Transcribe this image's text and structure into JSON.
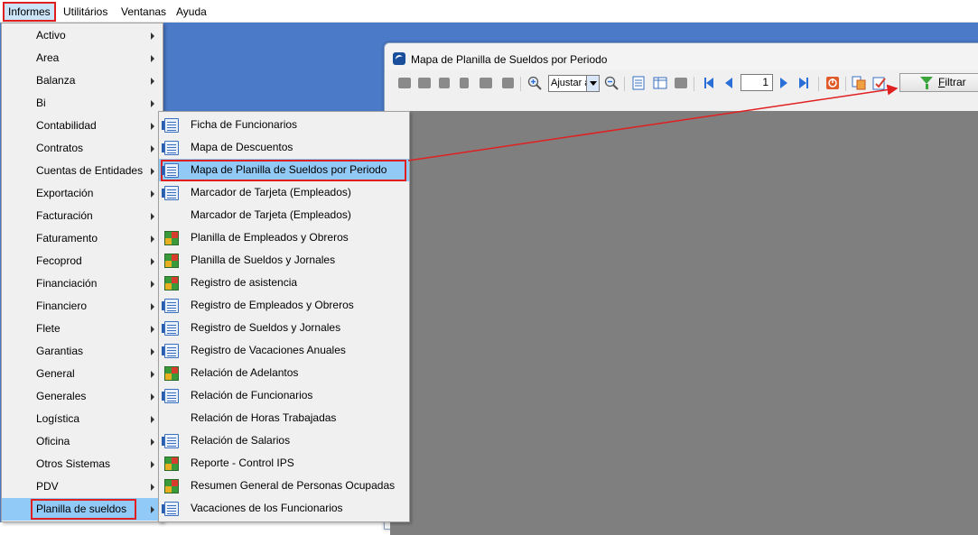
{
  "menubar": {
    "items": [
      {
        "label": "Informes",
        "active": true
      },
      {
        "label": "Utilitários"
      },
      {
        "label": "Ventanas"
      },
      {
        "label": "Ayuda"
      }
    ]
  },
  "report_window": {
    "title": "Mapa de Planilla de Sueldos por Periodo",
    "toolbar": {
      "zoom_value": "Ajustar a",
      "page_number": "1",
      "filter_label_first": "F",
      "filter_label_rest": "iltrar"
    }
  },
  "informes_menu": {
    "items": [
      {
        "label": "Activo"
      },
      {
        "label": "Area"
      },
      {
        "label": "Balanza"
      },
      {
        "label": "Bi"
      },
      {
        "label": "Contabilidad"
      },
      {
        "label": "Contratos"
      },
      {
        "label": "Cuentas de Entidades"
      },
      {
        "label": "Exportación"
      },
      {
        "label": "Facturación"
      },
      {
        "label": "Faturamento"
      },
      {
        "label": "Fecoprod"
      },
      {
        "label": "Financiación"
      },
      {
        "label": "Financiero"
      },
      {
        "label": "Flete"
      },
      {
        "label": "Garantias"
      },
      {
        "label": "General"
      },
      {
        "label": "Generales"
      },
      {
        "label": "Logística"
      },
      {
        "label": "Oficina"
      },
      {
        "label": "Otros Sistemas"
      },
      {
        "label": "PDV"
      },
      {
        "label": "Planilla de sueldos",
        "active": true
      }
    ]
  },
  "planilla_menu": {
    "items": [
      {
        "label": "Ficha de Funcionarios",
        "icon": "report-doc-icon"
      },
      {
        "label": "Mapa de Descuentos",
        "icon": "report-doc-icon"
      },
      {
        "label": "Mapa de Planilla de Sueldos por Periodo",
        "icon": "report-doc-icon",
        "active": true
      },
      {
        "label": "Marcador de Tarjeta (Empleados)",
        "icon": "report-doc-icon"
      },
      {
        "label": "Marcador de Tarjeta (Empleados)",
        "icon": ""
      },
      {
        "label": "Planilla de Empleados y Obreros",
        "icon": "spreadsheet-icon"
      },
      {
        "label": "Planilla de Sueldos y Jornales",
        "icon": "spreadsheet-icon"
      },
      {
        "label": "Registro de asistencia",
        "icon": "spreadsheet-icon"
      },
      {
        "label": "Registro de Empleados y Obreros",
        "icon": "report-doc-icon"
      },
      {
        "label": "Registro de Sueldos y Jornales",
        "icon": "report-doc-icon"
      },
      {
        "label": "Registro de Vacaciones Anuales",
        "icon": "report-doc-icon"
      },
      {
        "label": "Relación de Adelantos",
        "icon": "spreadsheet-icon"
      },
      {
        "label": "Relación de Funcionarios",
        "icon": "report-doc-icon"
      },
      {
        "label": "Relación de Horas Trabajadas",
        "icon": ""
      },
      {
        "label": "Relación de Salarios",
        "icon": "report-doc-icon"
      },
      {
        "label": "Reporte - Control IPS",
        "icon": "spreadsheet-icon"
      },
      {
        "label": "Resumen General de Personas Ocupadas",
        "icon": "spreadsheet-icon"
      },
      {
        "label": "Vacaciones de los Funcionarios",
        "icon": "report-doc-icon"
      }
    ]
  },
  "colors": {
    "desktop": "#4a7ac8",
    "highlight": "#91c9f7",
    "annotation_red": "#e02020",
    "report_canvas": "#7f7f7f"
  }
}
